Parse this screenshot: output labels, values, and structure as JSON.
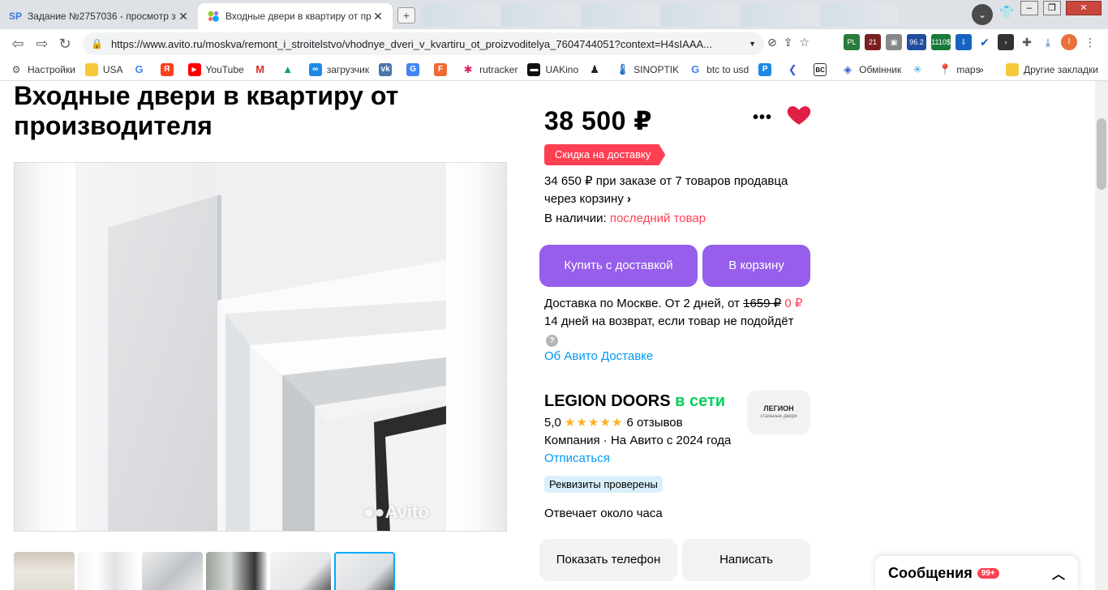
{
  "browser": {
    "tabs": [
      {
        "favicon": "SP",
        "title": "Задание №2757036 - просмотр з",
        "active": false
      },
      {
        "favicon": "avito-icon",
        "title": "Входные двери в квартиру от пр",
        "active": true
      }
    ],
    "url": "https://www.avito.ru/moskva/remont_i_stroitelstvo/vhodnye_dveri_v_kvartiru_ot_proizvoditelya_7604744051?context=H4sIAAA...",
    "extensions": [
      "PL",
      "21",
      "96.2",
      "1110$"
    ],
    "profile_initial": "I",
    "bookmarks": [
      {
        "icon": "gear-icon",
        "label": "Настройки"
      },
      {
        "icon": "folder-icon",
        "label": "USA"
      },
      {
        "icon": "google-icon",
        "label": ""
      },
      {
        "icon": "yandex-icon",
        "label": ""
      },
      {
        "icon": "youtube-icon",
        "label": "YouTube"
      },
      {
        "icon": "gmail-icon",
        "label": ""
      },
      {
        "icon": "drive-icon",
        "label": ""
      },
      {
        "icon": "loader-icon",
        "label": "загрузчик"
      },
      {
        "icon": "vk-icon",
        "label": ""
      },
      {
        "icon": "translate-icon",
        "label": ""
      },
      {
        "icon": "f-icon",
        "label": ""
      },
      {
        "icon": "rutracker-icon",
        "label": "rutracker"
      },
      {
        "icon": "uakino-icon",
        "label": "UAKino"
      },
      {
        "icon": "chess-icon",
        "label": ""
      },
      {
        "icon": "thermometer-icon",
        "label": "SINOPTIK"
      },
      {
        "icon": "google-icon",
        "label": "btc to usd"
      },
      {
        "icon": "p-icon",
        "label": ""
      },
      {
        "icon": "arrow-icon",
        "label": ""
      },
      {
        "icon": "bc-icon",
        "label": ""
      },
      {
        "icon": "exchange-icon",
        "label": "Обмінник"
      },
      {
        "icon": "star-icon",
        "label": ""
      },
      {
        "icon": "maps-icon",
        "label": "maps"
      }
    ],
    "more_bookmarks": "»",
    "other_bookmarks": "Другие закладки"
  },
  "listing": {
    "title": "Входные двери в квартиру от производителя",
    "photo_watermark": "Avito",
    "price": "38 500 ₽",
    "promo_badge": "Скидка на доставку",
    "bulk_offer_line1": "34 650 ₽ при заказе от 7 товаров продавца",
    "bulk_offer_line2": "через корзину",
    "bulk_offer_chevron": "›",
    "availability_label": "В наличии:",
    "availability_value": "последний товар",
    "buy_button": "Купить с доставкой",
    "cart_button": "В корзину",
    "delivery_text": "Доставка по Москве. От 2 дней, от",
    "delivery_old_price": "1659 ₽",
    "delivery_new_price": "0 ₽",
    "return_text": "14 дней на возврат, если товар не подойдёт",
    "help_glyph": "?",
    "about_delivery_link": "Об Авито Доставке"
  },
  "seller": {
    "name": "LEGION DOORS",
    "status": "в сети",
    "rating": "5,0",
    "stars": "★★★★★",
    "reviews": "6 отзывов",
    "type_line": "Компания · На Авито с 2024 года",
    "unsubscribe_link": "Отписаться",
    "verified_badge": "Реквизиты проверены",
    "response_time": "Отвечает около часа",
    "logo_text": "ЛЕГИОН",
    "logo_subtext": "стальные двери",
    "show_phone_button": "Показать телефон",
    "write_button": "Написать"
  },
  "messenger": {
    "label": "Сообщения",
    "badge": "99+",
    "chevron": "^"
  },
  "colors": {
    "accent_purple": "#965eeb",
    "promo_red": "#ff4053",
    "link_blue": "#0099f7",
    "online_green": "#02d15c",
    "heart_red": "#e01f45"
  }
}
